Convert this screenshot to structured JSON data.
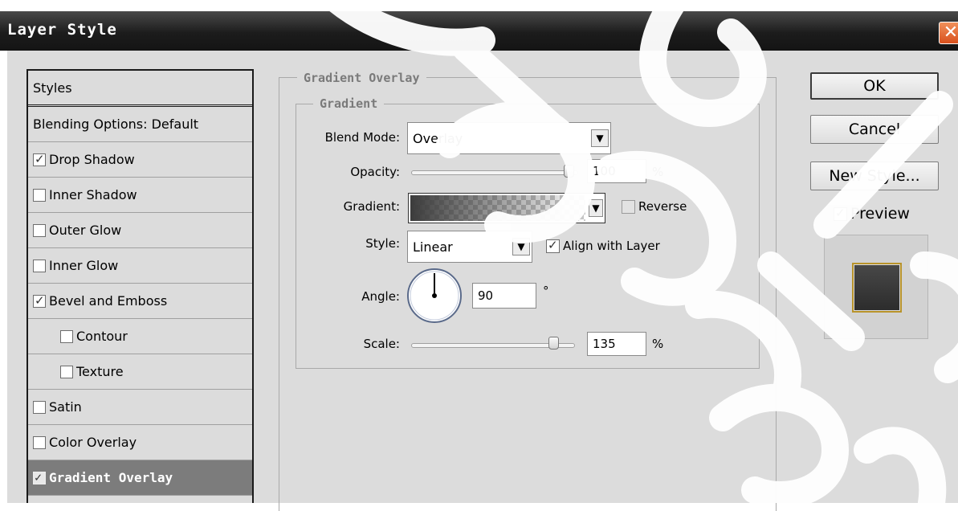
{
  "window": {
    "title": "Layer Style",
    "close_glyph": "✕"
  },
  "style_list": {
    "items": [
      {
        "label": "Styles",
        "has_checkbox": false,
        "checked": false,
        "selected": false
      },
      {
        "label": "Blending Options: Default",
        "has_checkbox": false,
        "checked": false,
        "selected": false
      },
      {
        "label": "Drop Shadow",
        "has_checkbox": true,
        "checked": true,
        "selected": false
      },
      {
        "label": "Inner Shadow",
        "has_checkbox": true,
        "checked": false,
        "selected": false
      },
      {
        "label": "Outer Glow",
        "has_checkbox": true,
        "checked": false,
        "selected": false
      },
      {
        "label": "Inner Glow",
        "has_checkbox": true,
        "checked": false,
        "selected": false
      },
      {
        "label": "Bevel and Emboss",
        "has_checkbox": true,
        "checked": true,
        "selected": false
      },
      {
        "label": "Contour",
        "has_checkbox": true,
        "checked": false,
        "selected": false
      },
      {
        "label": "Texture",
        "has_checkbox": true,
        "checked": false,
        "selected": false
      },
      {
        "label": "Satin",
        "has_checkbox": true,
        "checked": false,
        "selected": false
      },
      {
        "label": "Color Overlay",
        "has_checkbox": true,
        "checked": false,
        "selected": false
      },
      {
        "label": "Gradient Overlay",
        "has_checkbox": true,
        "checked": true,
        "selected": true
      }
    ]
  },
  "panel": {
    "section_title": "Gradient Overlay",
    "group_title": "Gradient",
    "blend_mode": {
      "label": "Blend Mode:",
      "value": "Overlay"
    },
    "opacity": {
      "label": "Opacity:",
      "value": "100",
      "unit": "%",
      "level": 1.0
    },
    "gradient": {
      "label": "Gradient:",
      "reverse_label": "Reverse",
      "reverse_checked": false
    },
    "style": {
      "label": "Style:",
      "value": "Linear",
      "align_label": "Align with Layer",
      "align_checked": true
    },
    "angle": {
      "label": "Angle:",
      "value": "90",
      "unit": "°"
    },
    "scale": {
      "label": "Scale:",
      "value": "135",
      "unit": "%",
      "level": 0.9
    }
  },
  "buttons": {
    "ok": "OK",
    "cancel": "Cancel",
    "new_style": "New Style...",
    "preview_label": "Preview",
    "preview_checked": true
  },
  "colors": {
    "title_bar": "#1c1c1c",
    "dialog_bg": "#dcdcdc",
    "selected_item": "#7c7c7c",
    "preview_border": "#b8932a"
  }
}
